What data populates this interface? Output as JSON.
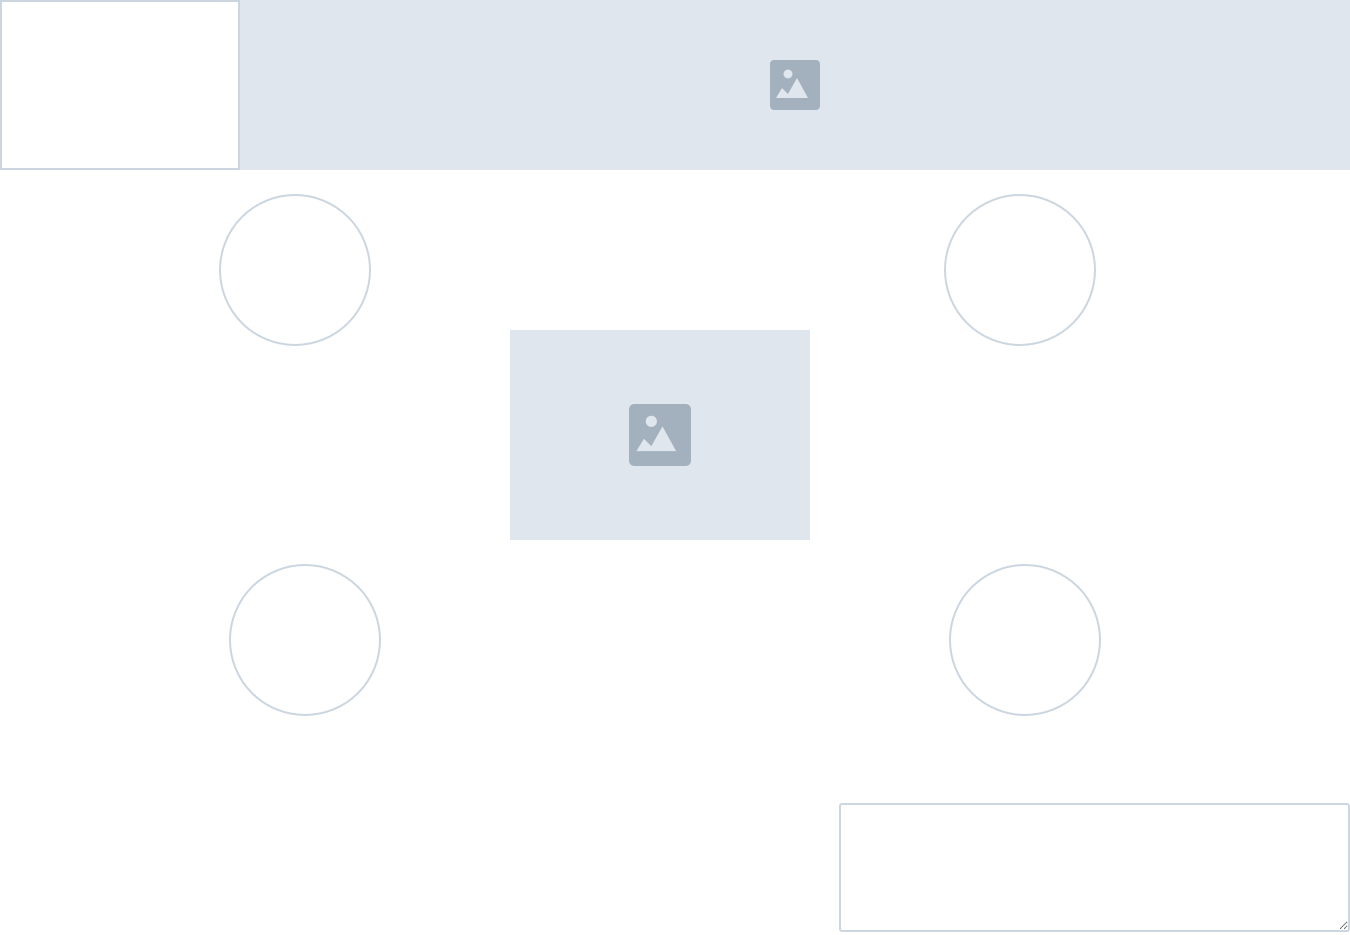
{
  "top_left_box": {},
  "banner": {
    "icon": "image-placeholder-icon"
  },
  "center_image": {
    "icon": "image-placeholder-icon"
  },
  "circles": [
    "avatar-placeholder",
    "avatar-placeholder",
    "avatar-placeholder",
    "avatar-placeholder"
  ],
  "textarea": {
    "value": "",
    "placeholder": ""
  },
  "colors": {
    "placeholder_fill": "#e0e6ee",
    "border": "#ccd6e0",
    "icon": "#a3b1bf",
    "background": "#ffffff"
  }
}
